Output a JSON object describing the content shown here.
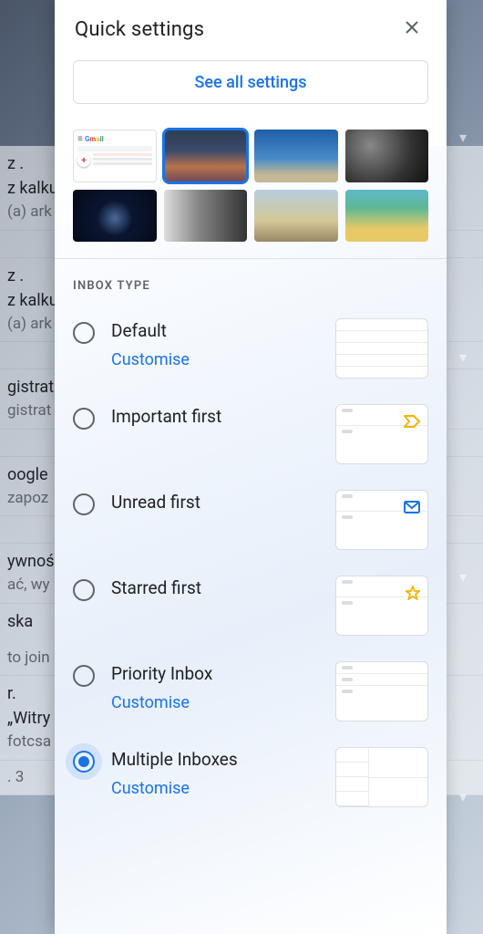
{
  "panel": {
    "title": "Quick settings",
    "see_all": "See all settings"
  },
  "background_rows": [
    {
      "l1": "z .",
      "l2": "z kalku",
      "l3": "(a) ark"
    },
    {
      "l1": "z .",
      "l2": "z kalku",
      "l3": "(a) ark"
    },
    {
      "l1": "gistrat",
      "l2": "gistrat",
      "l3": ""
    },
    {
      "l1": "oogle",
      "l2": "zapoz",
      "l3": ""
    },
    {
      "l1": "ywnoś",
      "l2": "ać, wy",
      "l3": ""
    },
    {
      "l1": "ska",
      "l2": "",
      "l3": "to join"
    },
    {
      "l1": "r.",
      "l2": "„Witry",
      "l3": "fotcsa"
    },
    {
      "l1": ". 3",
      "l2": "",
      "l3": ""
    }
  ],
  "themes": [
    {
      "name": "default-theme",
      "kind": "default"
    },
    {
      "name": "sunset-clouds-theme",
      "bg": "linear-gradient(180deg,#2c3e50 0%,#3b4a6b 40%,#b8724a 70%,#6b4a5a 100%)",
      "selected": true
    },
    {
      "name": "architecture-theme",
      "bg": "linear-gradient(180deg,#1e5fa8 0%,#4a8bc9 55%,#c4b896 85%)"
    },
    {
      "name": "pipes-theme",
      "bg": "radial-gradient(circle at 30% 30%,#888 0%,#333 60%,#111 100%)"
    },
    {
      "name": "planet-theme",
      "bg": "radial-gradient(circle at 50% 55%,#4a6a9a 0%,#0a1530 35%,#050a18 100%)"
    },
    {
      "name": "bw-building-theme",
      "bg": "linear-gradient(90deg,#ddd 0%,#888 40%,#333 100%)"
    },
    {
      "name": "seashore-theme",
      "bg": "linear-gradient(180deg,#b8cde0 0%,#d4c896 60%,#998866 100%)"
    },
    {
      "name": "beach-theme",
      "bg": "linear-gradient(180deg,#5eb8c9 0%,#5eb895 35%,#e8c968 75%)"
    }
  ],
  "inbox_type": {
    "label": "INBOX TYPE",
    "options": [
      {
        "id": "default",
        "label": "Default",
        "customise": "Customise",
        "selected": false
      },
      {
        "id": "important",
        "label": "Important first",
        "selected": false
      },
      {
        "id": "unread",
        "label": "Unread first",
        "selected": false
      },
      {
        "id": "starred",
        "label": "Starred first",
        "selected": false
      },
      {
        "id": "priority",
        "label": "Priority Inbox",
        "customise": "Customise",
        "selected": false
      },
      {
        "id": "multiple",
        "label": "Multiple Inboxes",
        "customise": "Customise",
        "selected": true
      }
    ]
  }
}
